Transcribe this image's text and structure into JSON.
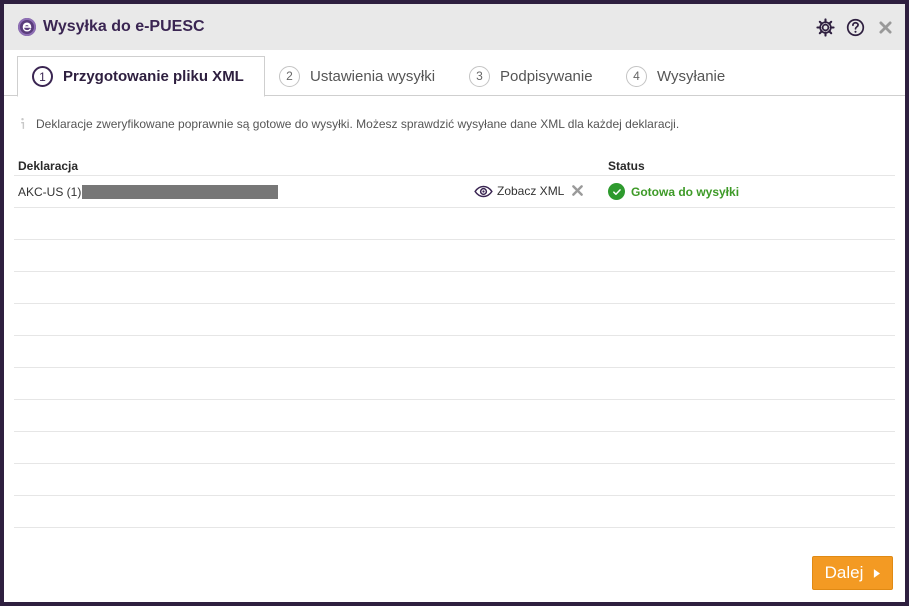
{
  "window": {
    "title": "Wysyłka do e-PUESC"
  },
  "tabs": [
    {
      "num": "1",
      "label": "Przygotowanie pliku XML"
    },
    {
      "num": "2",
      "label": "Ustawienia wysyłki"
    },
    {
      "num": "3",
      "label": "Podpisywanie"
    },
    {
      "num": "4",
      "label": "Wysyłanie"
    }
  ],
  "info": {
    "text": "Deklaracje zweryfikowane poprawnie są gotowe do wysyłki. Możesz sprawdzić wysyłane dane XML dla każdej deklaracji."
  },
  "grid": {
    "headers": {
      "declaration": "Deklaracja",
      "status": "Status"
    },
    "rows": [
      {
        "declaration": "AKC-US (1)",
        "view_label": "Zobacz XML",
        "status": "Gotowa do wysyłki"
      }
    ]
  },
  "footer": {
    "next_label": "Dalej"
  },
  "colors": {
    "accent": "#3a2552",
    "next": "#f39a23",
    "status_ok": "#3d9a27"
  }
}
